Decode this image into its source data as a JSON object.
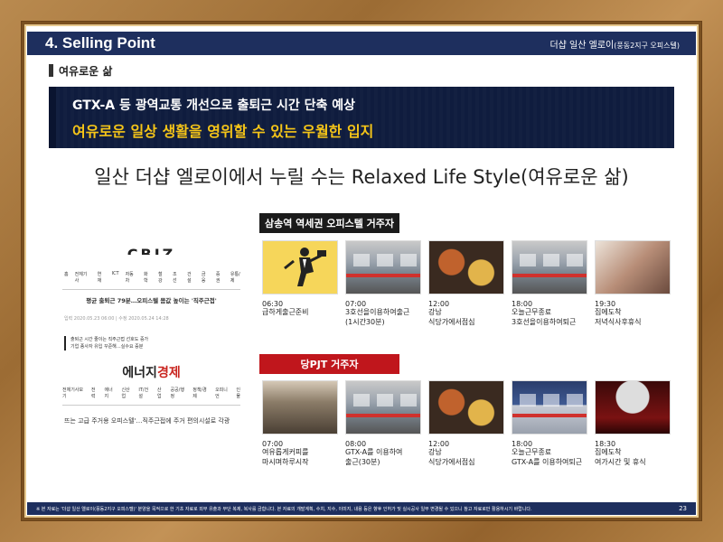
{
  "header": {
    "title": "4. Selling Point",
    "project": "더샵 일산 엘로이",
    "project_sub": "(풍동2지구 오피스텔)"
  },
  "section": {
    "title": "여유로운 삶"
  },
  "banner": {
    "line1": "GTX-A 등 광역교통 개선으로 출퇴근 시간 단축 예상",
    "line2": "여유로운 일상 생활을 영위할 수 있는 우월한 입지"
  },
  "headline": "일산 더샵 엘로이에서 누릴 수는 Relaxed Life Style(여유로운 삶)",
  "news": {
    "logo1": "CBIZ",
    "nav1": [
      "홈",
      "전체기사",
      "연재",
      "ICT",
      "자동차",
      "화학",
      "철강",
      "조선",
      "건설",
      "금융",
      "증권",
      "유통/제"
    ],
    "headline1": "평균 출퇴근 79분…오피스텔 몸값 높이는 '직주근접'",
    "meta1": "입력 2020.05.23 06:00 | 수정 2020.05.24 14:28",
    "quote1_a": "출퇴근 시간 줄이는 직주근접 선호도 증가",
    "quote1_b": "기업 종사자 유입 꾸준해…실수요 증분",
    "logo2_a": "에너지",
    "logo2_b": "경제",
    "nav2": [
      "전체기사보기",
      "전력",
      "에너지",
      "신산업",
      "IT/건설",
      "산업",
      "공공/행정",
      "정책/경제",
      "오피니언",
      "인물"
    ],
    "headline2": "뜨는 고급 주거용 오피스텔'…직주근접에 주거 편의시설로 각광"
  },
  "group1": {
    "tag": "삼송역 역세권 오피스텔 거주자",
    "items": [
      {
        "time": "06:30",
        "desc": [
          "급하게출근준비"
        ],
        "photo": "man-running"
      },
      {
        "time": "07:00",
        "desc": [
          "3호선을이용하여출근",
          "(1시간30분)"
        ],
        "photo": "subway-train"
      },
      {
        "time": "12:00",
        "desc": [
          "강남",
          "식당가에서점심"
        ],
        "photo": "food-table"
      },
      {
        "time": "18:00",
        "desc": [
          "오늘근무종료",
          "3호선을이용하여퇴근"
        ],
        "photo": "subway-train"
      },
      {
        "time": "19:30",
        "desc": [
          "집에도착",
          "저녁식사후휴식"
        ],
        "photo": "tired-woman"
      }
    ]
  },
  "group2": {
    "tag": "당PJT 거주자",
    "items": [
      {
        "time": "07:00",
        "desc": [
          "여유롭게커피를",
          "마시며하루시작"
        ],
        "photo": "window-coffee"
      },
      {
        "time": "08:00",
        "desc": [
          "GTX-A를 이용하여",
          "출근(30분)"
        ],
        "photo": "subway-train"
      },
      {
        "time": "12:00",
        "desc": [
          "강남",
          "식당가에서점심"
        ],
        "photo": "food-table"
      },
      {
        "time": "18:00",
        "desc": [
          "오늘근무종료",
          "GTX-A를 이용하여퇴근"
        ],
        "photo": "gtx-train"
      },
      {
        "time": "18:30",
        "desc": [
          "집에도착",
          "여가시간 및 휴식"
        ],
        "photo": "cinema"
      }
    ]
  },
  "footer": {
    "note": "※ 본 자료는 '더샵 일산 엘로이(풍동2지구 오피스텔)' 분양을 목적으로 한 기초 자료로 외부 유출과 무단 복제, 복사를 금합니다. 본 자료의 개발계획, 수치, 지수, 이미지, 내용 등은 향후 인허가 및 실시공사 일부 변경될 수 있으니 참고 자료로만 활용하시기 바랍니다.",
    "page": "23"
  },
  "colors": {
    "navy": "#1e2f5e",
    "banner": "#0f1c3e",
    "highlight": "#f5c518",
    "red_tag": "#c0161c"
  }
}
